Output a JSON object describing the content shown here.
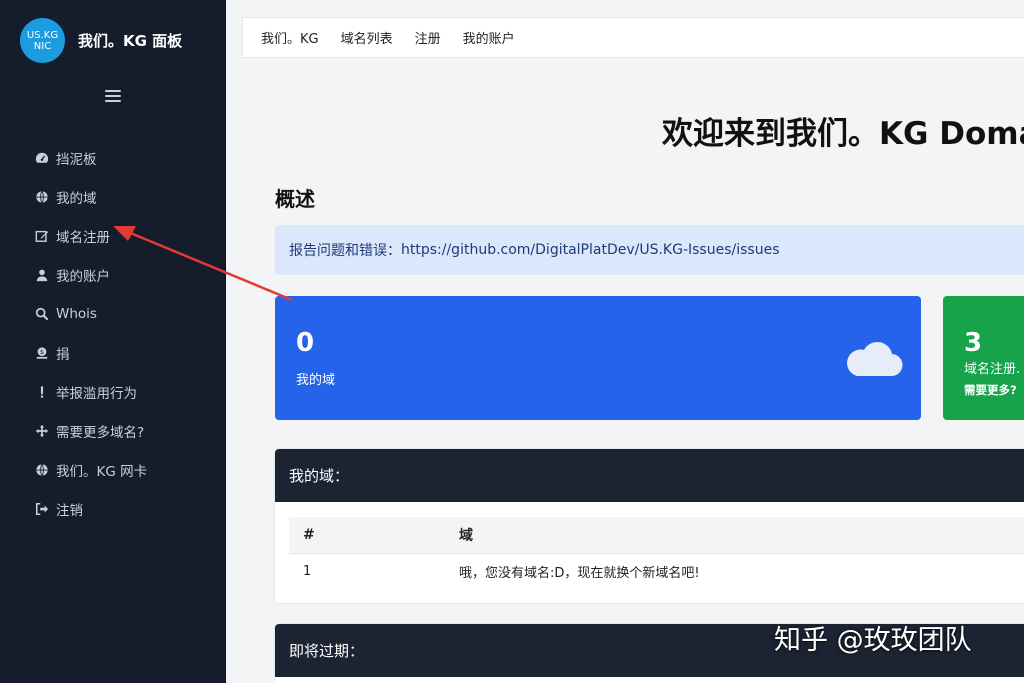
{
  "brand": {
    "logo_text": "US.KG NIC",
    "title": "我们。KG 面板"
  },
  "sidebar": {
    "items": [
      {
        "label": "挡泥板",
        "icon": "dashboard-icon"
      },
      {
        "label": "我的域",
        "icon": "globe-icon"
      },
      {
        "label": "域名注册",
        "icon": "edit-icon"
      },
      {
        "label": "我的账户",
        "icon": "user-icon"
      },
      {
        "label": "Whois",
        "icon": "search-icon"
      },
      {
        "label": "捐",
        "icon": "donate-icon"
      },
      {
        "label": "举报滥用行为",
        "icon": "exclamation-icon"
      },
      {
        "label": "需要更多域名?",
        "icon": "arrows-icon"
      },
      {
        "label": "我们。KG 网卡",
        "icon": "globe-icon"
      },
      {
        "label": "注销",
        "icon": "sign-out-icon"
      }
    ]
  },
  "topnav": {
    "items": [
      "我们。KG",
      "域名列表",
      "注册",
      "我的账户"
    ]
  },
  "main": {
    "welcome": "欢迎来到我们。KG Doma",
    "overview_title": "概述",
    "alert_prefix": "报告问题和错误：",
    "alert_url": "https://github.com/DigitalPlatDev/US.KG-Issues/issues",
    "cards": [
      {
        "value": "0",
        "label": "我的域",
        "color": "#2563eb"
      },
      {
        "value": "3",
        "label": "域名注册.",
        "sub": "需要更多?",
        "color": "#16a34a"
      }
    ],
    "domains_panel": {
      "title": "我的域：",
      "columns": [
        "#",
        "域"
      ],
      "rows": [
        [
          "1",
          "哦，您没有域名:D，现在就换个新域名吧!"
        ]
      ]
    },
    "expiring_panel": {
      "title": "即将过期："
    }
  },
  "watermark": "知乎 @玫玫团队",
  "colors": {
    "sidebar_bg": "#151c2c",
    "accent_blue": "#2563eb",
    "accent_green": "#16a34a",
    "annotation_arrow": "#e53935"
  }
}
